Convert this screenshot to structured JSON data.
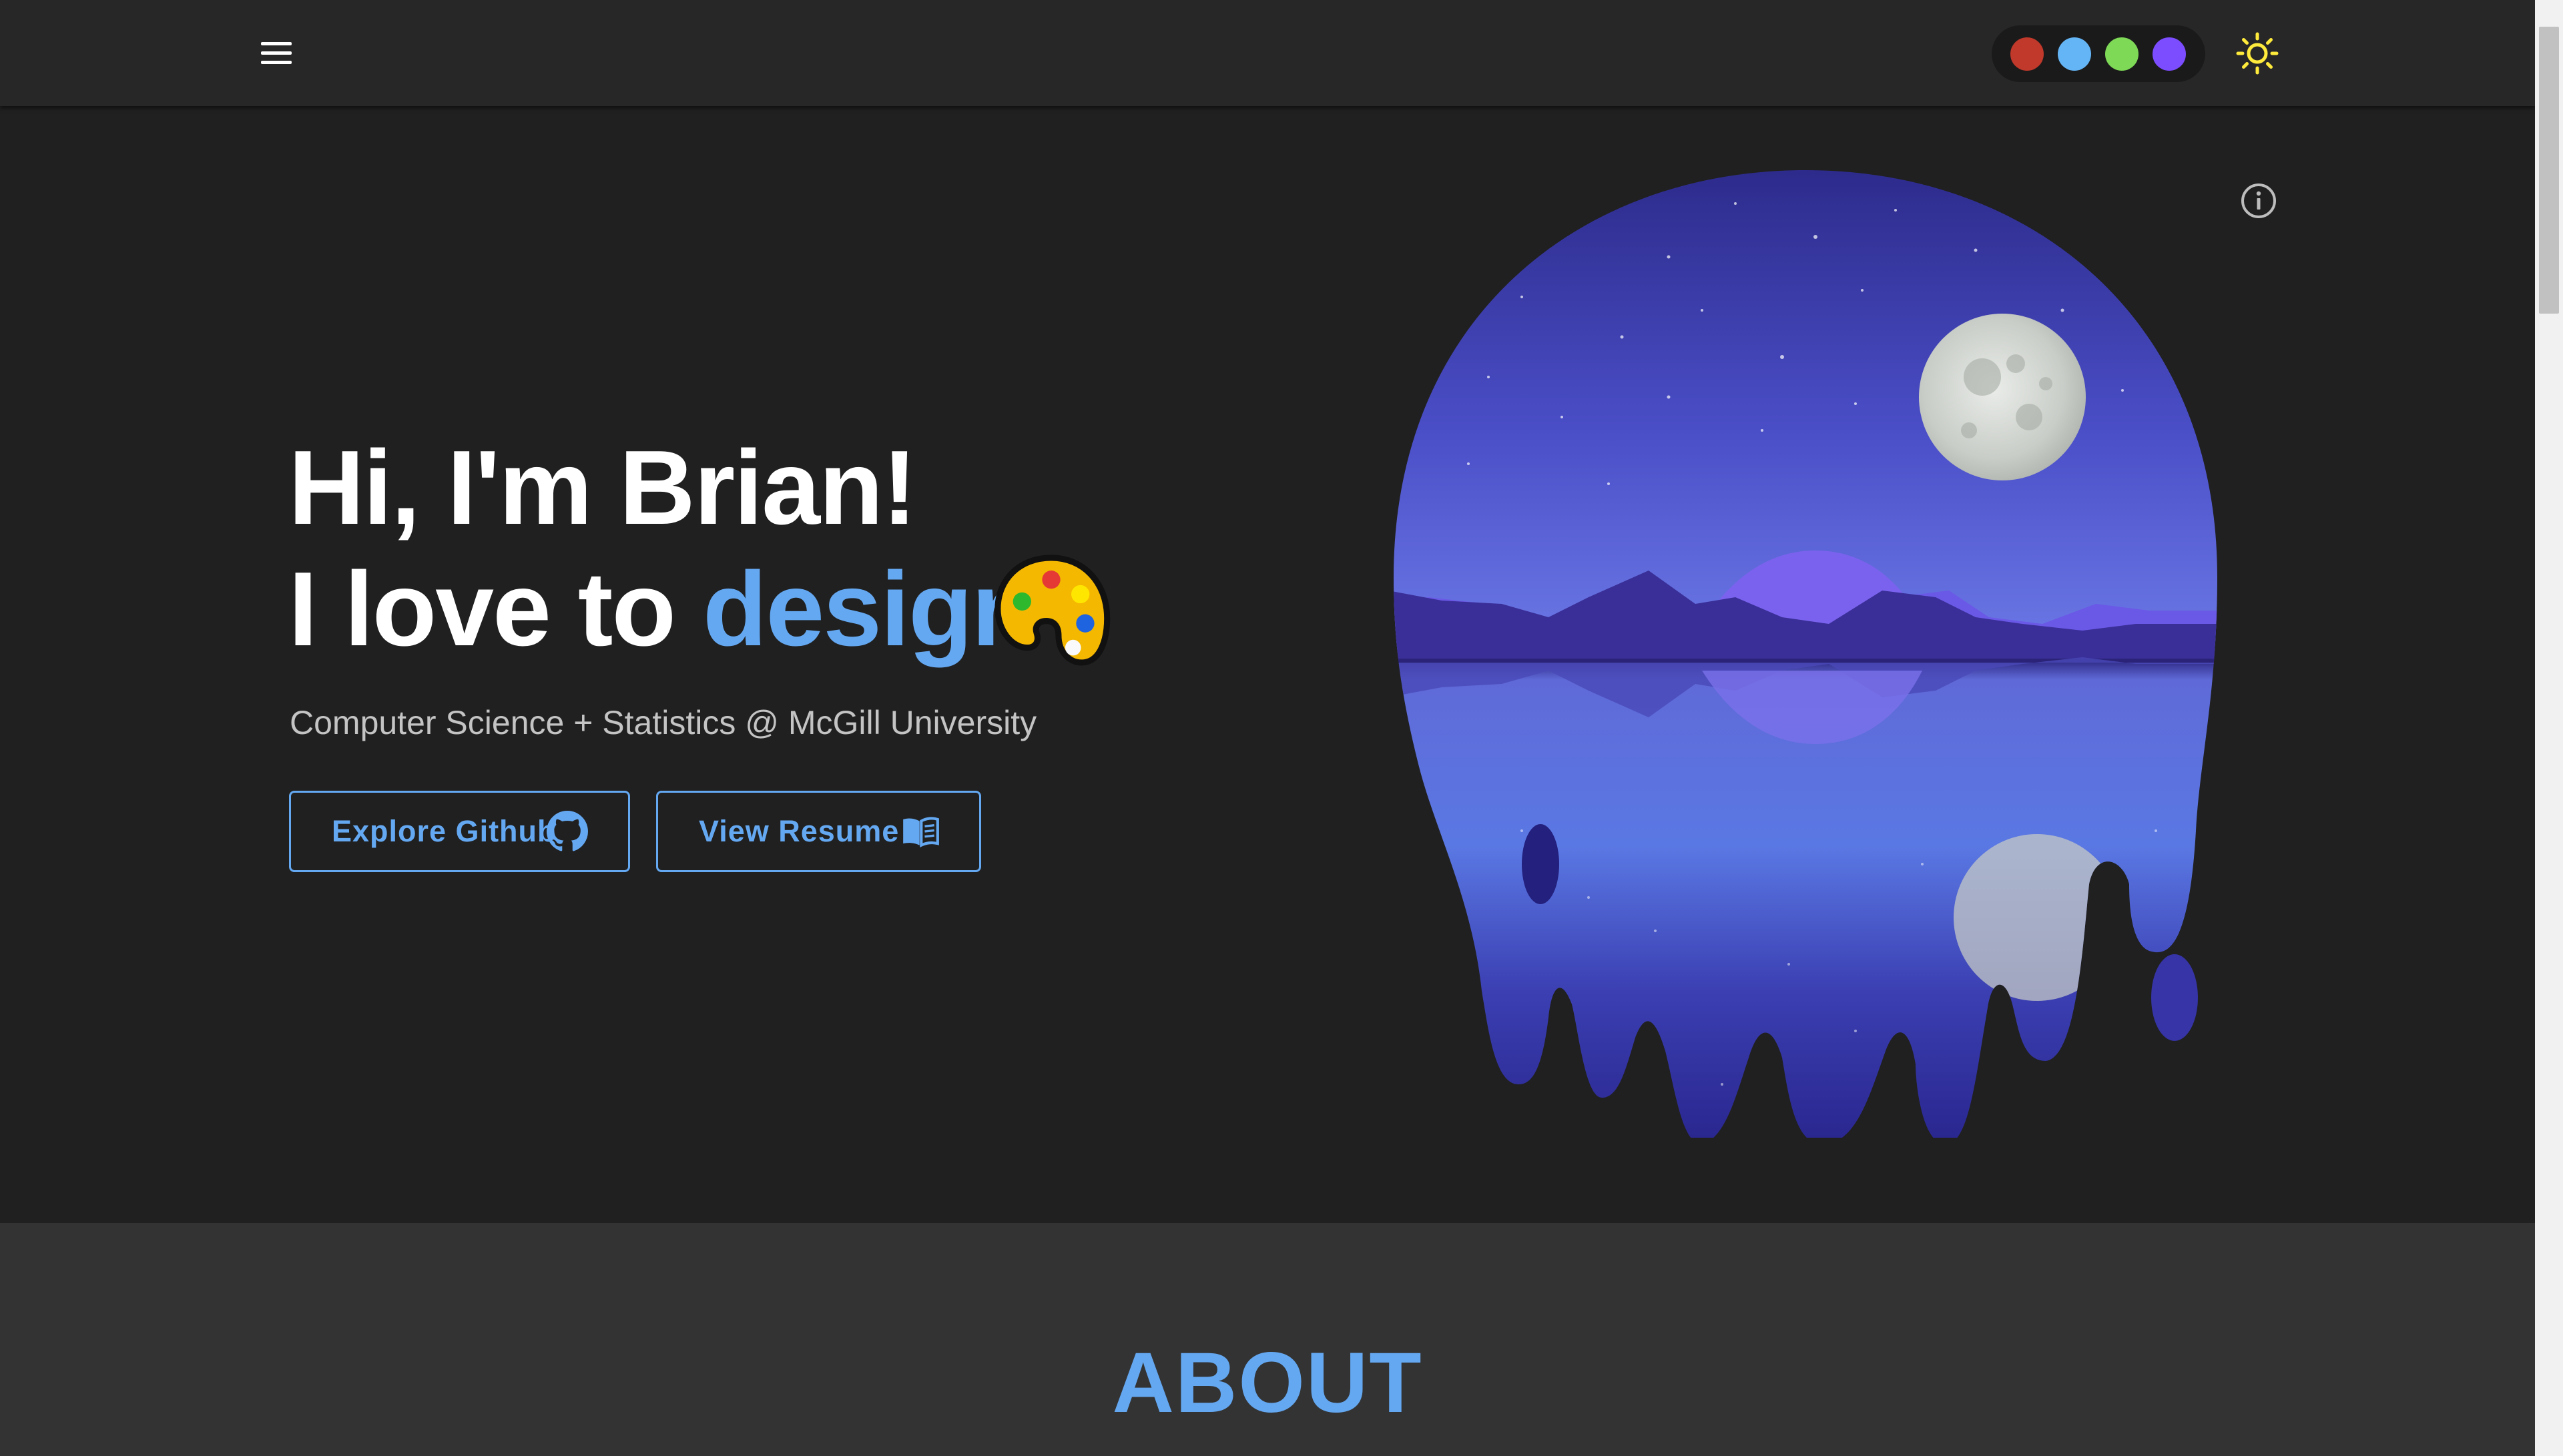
{
  "header": {
    "menu_icon": "hamburger-menu-icon",
    "theme_icon": "sun-icon",
    "theme_swatches": [
      {
        "name": "red",
        "color": "#c0392b"
      },
      {
        "name": "blue",
        "color": "#64b5f6"
      },
      {
        "name": "green",
        "color": "#7ed957"
      },
      {
        "name": "purple",
        "color": "#7c4dff"
      }
    ]
  },
  "hero": {
    "line1": "Hi, I'm Brian!",
    "line2_prefix": "I love to",
    "line2_accent": "design",
    "emoji_icon": "artist-palette-icon",
    "subtitle": "Computer Science + Statistics @ McGill University",
    "buttons": {
      "github": {
        "label": "Explore Github",
        "icon": "github-icon"
      },
      "resume": {
        "label": "View Resume",
        "icon": "book-icon"
      }
    },
    "info_icon": "info-icon",
    "illustration": "melting-moon-night-landscape"
  },
  "about": {
    "title": "ABOUT"
  },
  "colors": {
    "accent": "#64a8f2",
    "background": "#202020",
    "appbar": "#272727",
    "section_alt": "#333333",
    "sun": "#ffeb3b"
  }
}
